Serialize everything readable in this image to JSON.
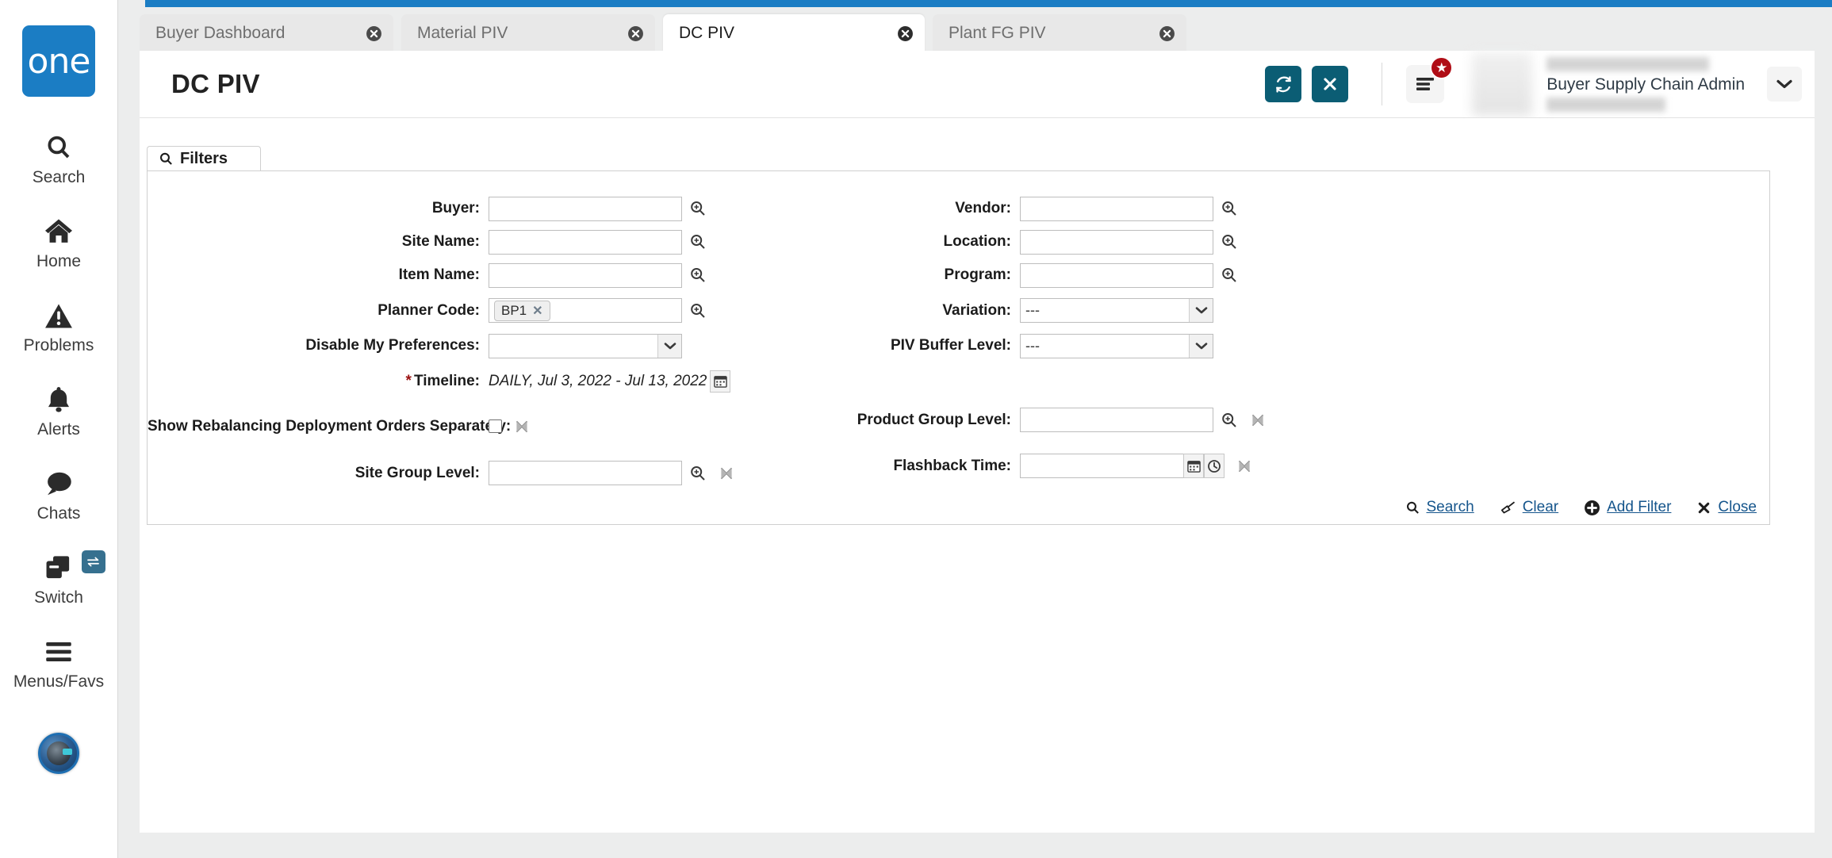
{
  "brand": {
    "logo_text": "one",
    "accent_teal": "#0b5d74",
    "accent_blue": "#1b7dc4",
    "badge_red": "#b00d16"
  },
  "sidebar": {
    "items": [
      {
        "label": "Search",
        "icon": "search-icon"
      },
      {
        "label": "Home",
        "icon": "home-icon"
      },
      {
        "label": "Problems",
        "icon": "warning-triangle-icon"
      },
      {
        "label": "Alerts",
        "icon": "bell-icon"
      },
      {
        "label": "Chats",
        "icon": "chat-bubble-icon"
      },
      {
        "label": "Switch",
        "icon": "switch-windows-icon"
      },
      {
        "label": "Menus/Favs",
        "icon": "hamburger-icon"
      }
    ],
    "assistant_label": "assistant-avatar"
  },
  "tabs": [
    {
      "label": "Buyer Dashboard",
      "active": false
    },
    {
      "label": "Material PIV",
      "active": false
    },
    {
      "label": "DC PIV",
      "active": true
    },
    {
      "label": "Plant FG PIV",
      "active": false
    }
  ],
  "header": {
    "title": "DC PIV",
    "refresh_icon": "refresh-icon",
    "close_icon": "close-x-icon",
    "menu_icon": "hamburger-menu-icon",
    "favorites_badge_icon": "star-icon",
    "user_role": "Buyer Supply Chain Admin",
    "user_caret_icon": "chevron-down-icon"
  },
  "filters": {
    "tab_label": "Filters",
    "tab_icon": "search-icon",
    "left_fields": [
      {
        "label": "Buyer:",
        "type": "lookup",
        "value": "",
        "required": false
      },
      {
        "label": "Site Name:",
        "type": "lookup",
        "value": "",
        "required": false
      },
      {
        "label": "Item Name:",
        "type": "lookup",
        "value": "",
        "required": false
      },
      {
        "label": "Planner Code:",
        "type": "lookup-chip",
        "value": "",
        "chip": "BP1",
        "required": false
      },
      {
        "label": "Disable My Preferences:",
        "type": "select",
        "value": "",
        "required": false
      },
      {
        "label": "Timeline:",
        "type": "timeline",
        "value": "DAILY, Jul 3, 2022 - Jul 13, 2022",
        "required": true
      },
      {
        "label": "Show Rebalancing Deployment Orders Separately:",
        "type": "checkbox",
        "value": "",
        "checked": false,
        "required": false
      },
      {
        "label": "Site Group Level:",
        "type": "lookup-clear",
        "value": "",
        "required": false
      }
    ],
    "right_fields": [
      {
        "label": "Vendor:",
        "type": "lookup",
        "value": "",
        "required": false
      },
      {
        "label": "Location:",
        "type": "lookup",
        "value": "",
        "required": false
      },
      {
        "label": "Program:",
        "type": "lookup",
        "value": "",
        "required": false
      },
      {
        "label": "Variation:",
        "type": "select",
        "value": "---",
        "required": false
      },
      {
        "label": "PIV Buffer Level:",
        "type": "select",
        "value": "---",
        "required": false
      },
      {
        "label": "Product Group Level:",
        "type": "lookup-clear",
        "value": "",
        "required": false
      },
      {
        "label": "Flashback Time:",
        "type": "datetime-clear",
        "value": "",
        "required": false
      }
    ],
    "actions": [
      {
        "label": "Search",
        "icon": "search-icon"
      },
      {
        "label": "Clear",
        "icon": "eraser-icon"
      },
      {
        "label": "Add Filter",
        "icon": "plus-circle-icon"
      },
      {
        "label": "Close",
        "icon": "close-x-icon"
      }
    ]
  }
}
